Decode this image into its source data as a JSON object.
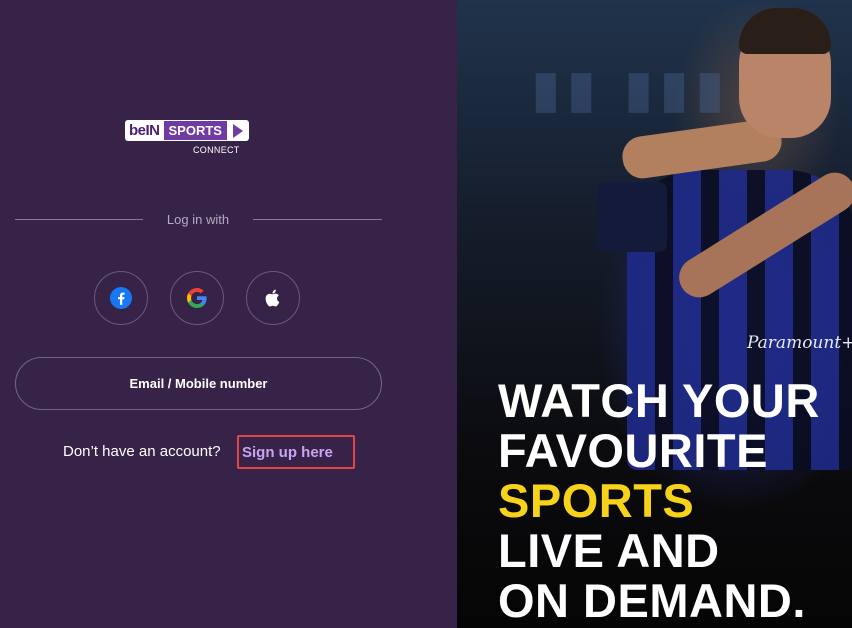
{
  "logo": {
    "bein": "beIN",
    "sports": "SPORTS",
    "connect": "CONNECT"
  },
  "login": {
    "divider_text": "Log in with",
    "social": [
      {
        "name": "facebook",
        "icon": "facebook-icon",
        "color": "#1877F2"
      },
      {
        "name": "google",
        "icon": "google-icon"
      },
      {
        "name": "apple",
        "icon": "apple-icon",
        "color": "#ffffff"
      }
    ],
    "email_button_label": "Email / Mobile number",
    "no_account_text": "Don’t have an account?",
    "signup_link": "Sign up here"
  },
  "hero": {
    "lines": [
      "WATCH YOUR",
      "FAVOURITE",
      "SPORTS",
      "LIVE AND",
      "ON DEMAND."
    ],
    "highlight_color": "#F7D21B",
    "sponsor": "Paramount+"
  },
  "colors": {
    "panel_bg": "#362347",
    "link": "#C9A3F2",
    "focus_border": "#E0454B"
  }
}
